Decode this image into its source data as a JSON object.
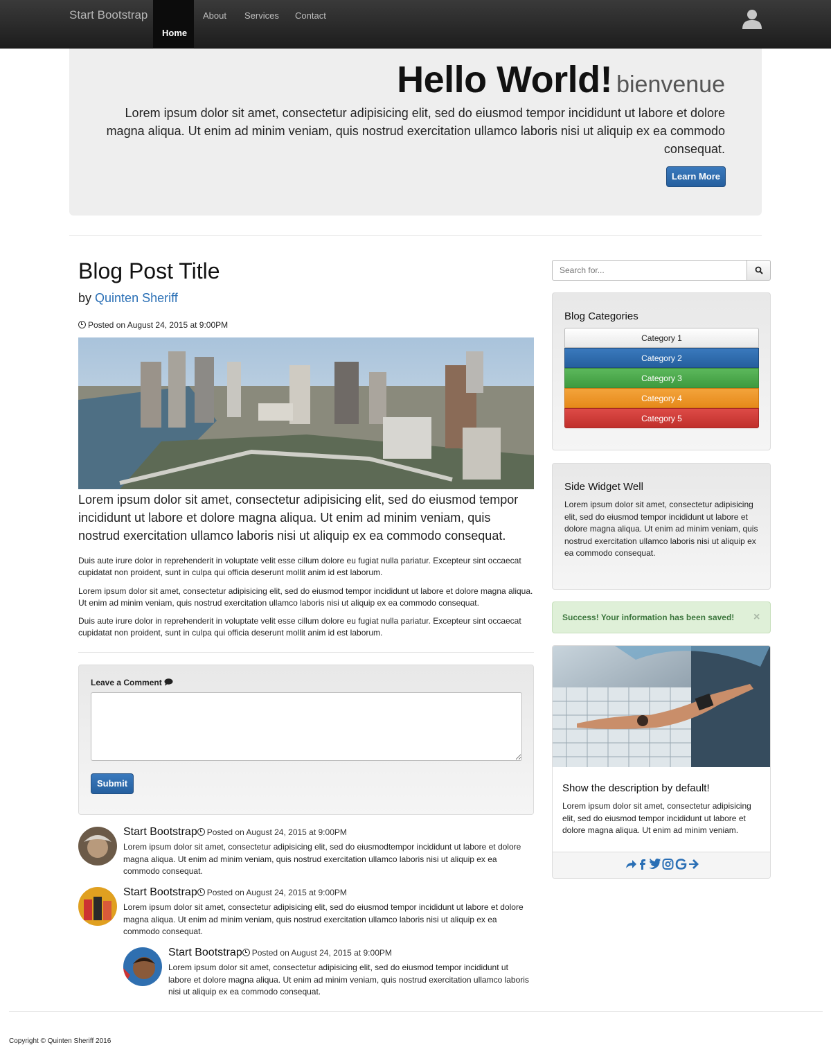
{
  "navbar": {
    "brand": "Start Bootstrap",
    "links": [
      "Home",
      "About",
      "Services",
      "Contact"
    ],
    "active": "Home"
  },
  "jumbotron": {
    "title": "Hello World!",
    "subtitle": "bienvenue",
    "text": "Lorem ipsum dolor sit amet, consectetur adipisicing elit, sed do eiusmod tempor incididunt ut labore et dolore magna aliqua. Ut enim ad minim veniam, quis nostrud exercitation ullamco laboris nisi ut aliquip ex ea commodo consequat.",
    "button": "Learn More"
  },
  "post": {
    "title": "Blog Post Title",
    "by": "by",
    "author": "Quinten Sheriff",
    "posted": "Posted on August 24, 2015 at 9:00PM",
    "lead": "Lorem ipsum dolor sit amet, consectetur adipisicing elit, sed do eiusmod tempor incididunt ut labore et dolore magna aliqua. Ut enim ad minim veniam, quis nostrud exercitation ullamco laboris nisi ut aliquip ex ea commodo consequat.",
    "paragraphs": [
      "Duis aute irure dolor in reprehenderit in voluptate velit esse cillum dolore eu fugiat nulla pariatur. Excepteur sint occaecat cupidatat non proident, sunt in culpa qui officia deserunt mollit anim id est laborum.",
      "Lorem ipsum dolor sit amet, consectetur adipisicing elit, sed do eiusmod tempor incididunt ut labore et dolore magna aliqua. Ut enim ad minim veniam, quis nostrud exercitation ullamco laboris nisi ut aliquip ex ea commodo consequat.",
      "Duis aute irure dolor in reprehenderit in voluptate velit esse cillum dolore eu fugiat nulla pariatur. Excepteur sint occaecat cupidatat non proident, sunt in culpa qui officia deserunt mollit anim id est laborum."
    ]
  },
  "comment_form": {
    "label": "Leave a Comment",
    "value": "",
    "submit": "Submit"
  },
  "comments": [
    {
      "name": "Start Bootstrap",
      "posted": "Posted on August 24, 2015 at 9:00PM",
      "text": "Lorem ipsum dolor sit amet, consectetur adipisicing elit, sed do eiusmodtempor incididunt ut labore et dolore magna aliqua. Ut enim ad minim veniam, quis nostrud exercitation ullamco laboris nisi ut aliquip ex ea commodo consequat."
    },
    {
      "name": "Start Bootstrap",
      "posted": "Posted on August 24, 2015 at 9:00PM",
      "text": "Lorem ipsum dolor sit amet, consectetur adipisicing elit, sed do eiusmod tempor incididunt ut labore et dolore magna aliqua. Ut enim ad minim veniam, quis nostrud exercitation ullamco laboris nisi ut aliquip ex ea commodo consequat."
    },
    {
      "name": "Start Bootstrap",
      "posted": "Posted on August 24, 2015 at 9:00PM",
      "text": "Lorem ipsum dolor sit amet, consectetur adipisicing elit, sed do eiusmod tempor incididunt ut labore et dolore magna aliqua. Ut enim ad minim veniam, quis nostrud exercitation ullamco laboris nisi ut aliquip ex ea commodo consequat."
    }
  ],
  "sidebar": {
    "search_placeholder": "Search for...",
    "categories_title": "Blog Categories",
    "categories": [
      "Category 1",
      "Category 2",
      "Category 3",
      "Category 4",
      "Category 5"
    ],
    "widget_title": "Side Widget Well",
    "widget_text": "Lorem ipsum dolor sit amet, consectetur adipisicing elit, sed do eiusmod tempor incididunt ut labore et dolore magna aliqua. Ut enim ad minim veniam, quis nostrud exercitation ullamco laboris nisi ut aliquip ex ea commodo consequat.",
    "alert": "Success! Your information has been saved!",
    "alert_close": "×",
    "card_title": "Show the description by default!",
    "card_text": "Lorem ipsum dolor sit amet, consectetur adipisicing elit, sed do eiusmod tempor incididunt ut labore et dolore magna aliqua. Ut enim ad minim veniam.",
    "share_icons": [
      "share-icon",
      "facebook-icon",
      "twitter-icon",
      "instagram-icon",
      "google-icon",
      "arrow-right-icon"
    ]
  },
  "footer": {
    "copyright": "Copyright © Quinten Sheriff 2016"
  },
  "colors": {
    "primary": "#2a6fb5",
    "success": "#5cb85c",
    "warning": "#f0ad4e",
    "danger": "#d9534f"
  }
}
